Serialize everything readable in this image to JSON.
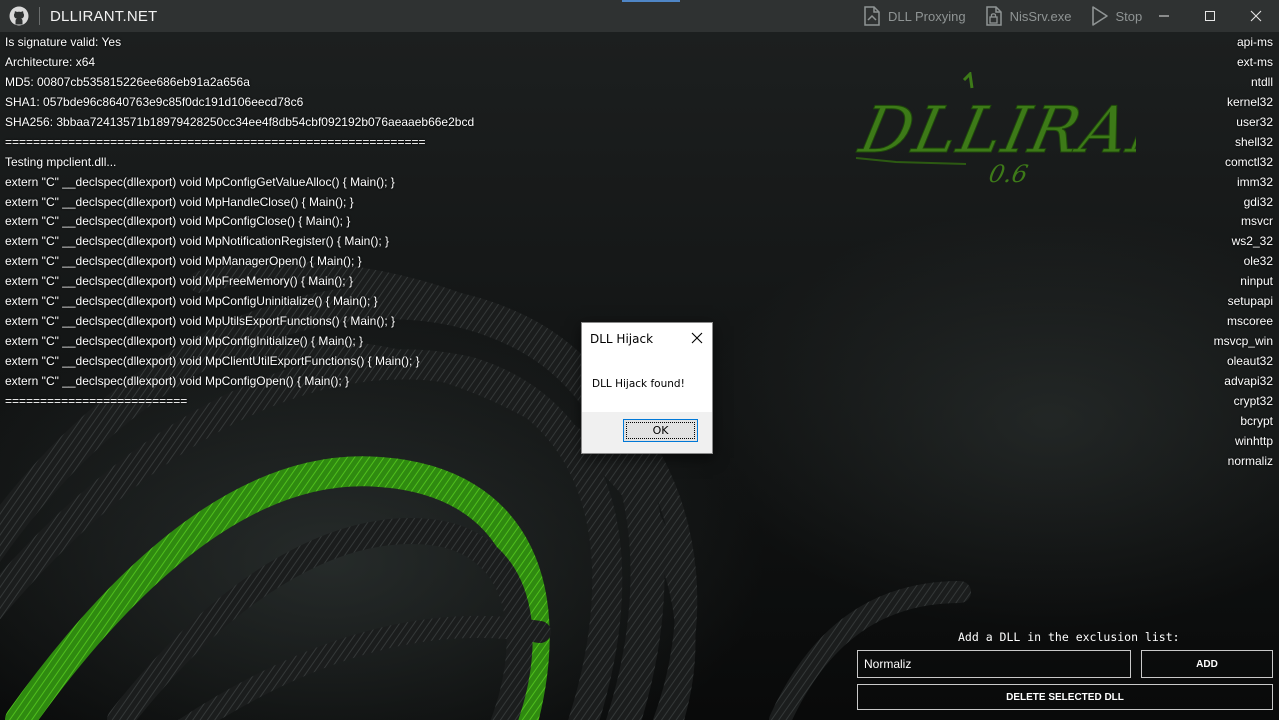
{
  "app": {
    "title": "DLLIRANT.NET",
    "accent_color": "#4f86c6"
  },
  "toolbar": {
    "tools": [
      {
        "label": "DLL Proxying",
        "icon": "file-proxy-icon"
      },
      {
        "label": "NisSrv.exe",
        "icon": "file-lock-icon"
      },
      {
        "label": "Stop",
        "icon": "play-icon"
      }
    ],
    "window_controls": [
      "minimize-icon",
      "maximize-icon",
      "close-icon"
    ]
  },
  "log": {
    "lines": [
      "Is signature valid: Yes",
      "Architecture: x64",
      "MD5: 00807cb535815226ee686eb91a2a656a",
      "SHA1: 057bde96c8640763e9c85f0dc191d106eecd78c6",
      "SHA256: 3bbaa72413571b18979428250cc34ee4f8db54cbf092192b076aeaaeb66e2bcd",
      "============================================================",
      "Testing mpclient.dll...",
      "extern \"C\" __declspec(dllexport) void MpConfigGetValueAlloc() { Main(); }",
      "extern \"C\" __declspec(dllexport) void MpHandleClose() { Main(); }",
      "extern \"C\" __declspec(dllexport) void MpConfigClose() { Main(); }",
      "extern \"C\" __declspec(dllexport) void MpNotificationRegister() { Main(); }",
      "extern \"C\" __declspec(dllexport) void MpManagerOpen() { Main(); }",
      "extern \"C\" __declspec(dllexport) void MpFreeMemory() { Main(); }",
      "extern \"C\" __declspec(dllexport) void MpConfigUninitialize() { Main(); }",
      "extern \"C\" __declspec(dllexport) void MpUtilsExportFunctions() { Main(); }",
      "extern \"C\" __declspec(dllexport) void MpConfigInitialize() { Main(); }",
      "extern \"C\" __declspec(dllexport) void MpClientUtilExportFunctions() { Main(); }",
      "extern \"C\" __declspec(dllexport) void MpConfigOpen() { Main(); }",
      "=========================="
    ]
  },
  "logo": {
    "text": "DLLIRANT",
    "version": "0.6",
    "color": "#4a8a1c"
  },
  "modules": [
    "api-ms",
    "ext-ms",
    "ntdll",
    "kernel32",
    "user32",
    "shell32",
    "comctl32",
    "imm32",
    "gdi32",
    "msvcr",
    "ws2_32",
    "ole32",
    "ninput",
    "setupapi",
    "mscoree",
    "msvcp_win",
    "oleaut32",
    "advapi32",
    "crypt32",
    "bcrypt",
    "winhttp",
    "normaliz"
  ],
  "exclusion": {
    "label": "Add a DLL in the exclusion list:",
    "input_value": "Normaliz",
    "add_label": "ADD",
    "delete_label": "DELETE SELECTED DLL"
  },
  "dialog": {
    "title": "DLL Hijack",
    "message": "DLL Hijack found!",
    "ok_label": "OK"
  }
}
